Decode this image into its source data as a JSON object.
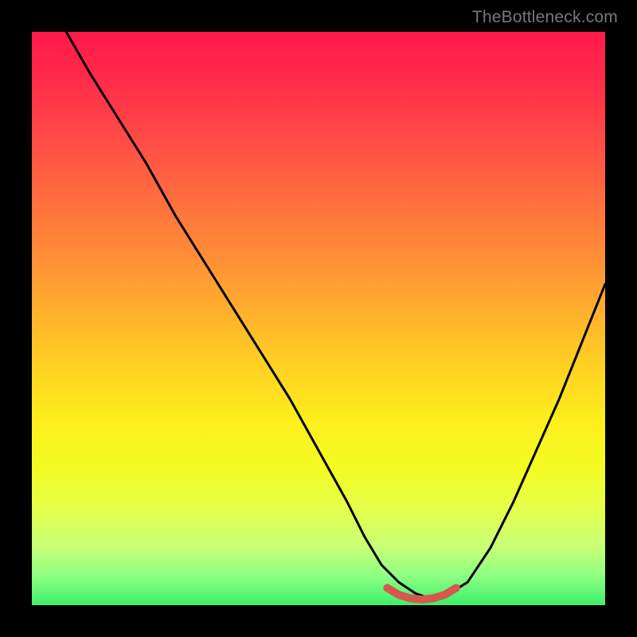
{
  "watermark": "TheBottleneck.com",
  "chart_data": {
    "type": "line",
    "title": "",
    "xlabel": "",
    "ylabel": "",
    "xlim": [
      0,
      100
    ],
    "ylim": [
      0,
      100
    ],
    "series": [
      {
        "name": "black-curve",
        "color": "#000000",
        "x": [
          6,
          10,
          15,
          20,
          25,
          30,
          35,
          40,
          45,
          50,
          55,
          58,
          61,
          64,
          67,
          70,
          72,
          76,
          80,
          84,
          88,
          92,
          96,
          100
        ],
        "y": [
          100,
          93,
          85,
          77,
          68,
          60,
          52,
          44,
          36,
          27,
          18,
          12,
          7,
          4,
          2,
          1,
          1.5,
          4,
          10,
          18,
          27,
          36,
          46,
          56
        ]
      },
      {
        "name": "red-bottom-segment",
        "color": "#d6574f",
        "x": [
          62,
          64,
          66,
          68,
          70,
          72,
          74
        ],
        "y": [
          3.0,
          1.8,
          1.2,
          1.0,
          1.2,
          1.8,
          3.0
        ]
      }
    ]
  }
}
